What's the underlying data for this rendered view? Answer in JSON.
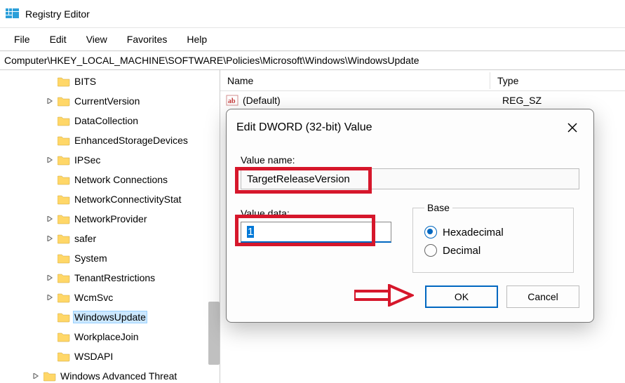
{
  "app": {
    "title": "Registry Editor"
  },
  "menu": {
    "file": "File",
    "edit": "Edit",
    "view": "View",
    "favorites": "Favorites",
    "help": "Help"
  },
  "address": {
    "path": "Computer\\HKEY_LOCAL_MACHINE\\SOFTWARE\\Policies\\Microsoft\\Windows\\WindowsUpdate"
  },
  "tree": {
    "items": [
      {
        "expander": "",
        "label": "BITS",
        "indent": 1
      },
      {
        "expander": ">",
        "label": "CurrentVersion",
        "indent": 1
      },
      {
        "expander": "",
        "label": "DataCollection",
        "indent": 1
      },
      {
        "expander": "",
        "label": "EnhancedStorageDevices",
        "indent": 1
      },
      {
        "expander": ">",
        "label": "IPSec",
        "indent": 1
      },
      {
        "expander": "",
        "label": "Network Connections",
        "indent": 1
      },
      {
        "expander": "",
        "label": "NetworkConnectivityStat",
        "indent": 1
      },
      {
        "expander": ">",
        "label": "NetworkProvider",
        "indent": 1
      },
      {
        "expander": ">",
        "label": "safer",
        "indent": 1
      },
      {
        "expander": "",
        "label": "System",
        "indent": 1
      },
      {
        "expander": ">",
        "label": "TenantRestrictions",
        "indent": 1
      },
      {
        "expander": ">",
        "label": "WcmSvc",
        "indent": 1
      },
      {
        "expander": "",
        "label": "WindowsUpdate",
        "indent": 1,
        "selected": true
      },
      {
        "expander": "",
        "label": "WorkplaceJoin",
        "indent": 1
      },
      {
        "expander": "",
        "label": "WSDAPI",
        "indent": 1
      },
      {
        "expander": ">",
        "label": "Windows Advanced Threat",
        "indent": 0
      }
    ]
  },
  "list": {
    "headers": {
      "name": "Name",
      "type": "Type"
    },
    "rows": [
      {
        "icon": "ab",
        "name": "(Default)",
        "type": "REG_SZ"
      }
    ]
  },
  "dialog": {
    "title": "Edit DWORD (32-bit) Value",
    "value_name_label": "Value name:",
    "value_name": "TargetReleaseVersion",
    "value_data_label": "Value data:",
    "value_data": "1",
    "base_label": "Base",
    "radio_hex": "Hexadecimal",
    "radio_dec": "Decimal",
    "ok": "OK",
    "cancel": "Cancel"
  }
}
